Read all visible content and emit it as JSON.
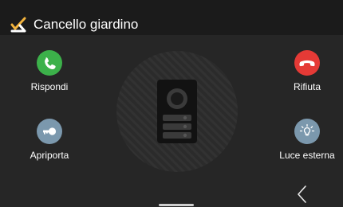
{
  "header": {
    "title": "Cancello giardino",
    "icon": "gate-icon",
    "accent_color": "#f2b33d"
  },
  "actions": {
    "answer": {
      "label": "Rispondi",
      "icon": "phone-answer-icon",
      "color": "#3cb14a"
    },
    "reject": {
      "label": "Rifiuta",
      "icon": "phone-hangup-icon",
      "color": "#e53a36"
    },
    "door": {
      "label": "Apriporta",
      "icon": "key-icon",
      "color": "#7b98ad"
    },
    "light": {
      "label": "Luce esterna",
      "icon": "light-bulb-icon",
      "color": "#7b98ad"
    }
  },
  "center": {
    "icon": "door-station-icon"
  },
  "nav": {
    "back_icon": "chevron-left-icon"
  }
}
